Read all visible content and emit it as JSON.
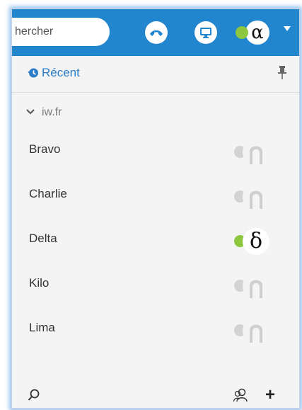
{
  "header": {
    "search_value": "hercher",
    "self_avatar_letter": "α",
    "self_status_color": "#8dc63f",
    "accent": "#2286cf",
    "icons": [
      "phone-hangup-icon",
      "screen-share-icon",
      "chevron-down-icon"
    ]
  },
  "recent": {
    "label": "Récent",
    "icons": [
      "history-icon",
      "pin-icon"
    ]
  },
  "group": {
    "label": "iw.fr",
    "expanded": true
  },
  "contacts": [
    {
      "name": "Bravo",
      "status": "offline",
      "status_color": "#d3d3d3",
      "avatar": "person-silhouette-icon"
    },
    {
      "name": "Charlie",
      "status": "offline",
      "status_color": "#d3d3d3",
      "avatar": "person-silhouette-icon"
    },
    {
      "name": "Delta",
      "status": "online",
      "status_color": "#8dc63f",
      "avatar_letter": "δ"
    },
    {
      "name": "Kilo",
      "status": "offline",
      "status_color": "#d3d3d3",
      "avatar": "person-silhouette-icon"
    },
    {
      "name": "Lima",
      "status": "offline",
      "status_color": "#d3d3d3",
      "avatar": "person-silhouette-icon"
    }
  ],
  "footer": {
    "add_label": "+",
    "icons": [
      "search-icon",
      "contacts-group-icon",
      "add-icon"
    ]
  }
}
